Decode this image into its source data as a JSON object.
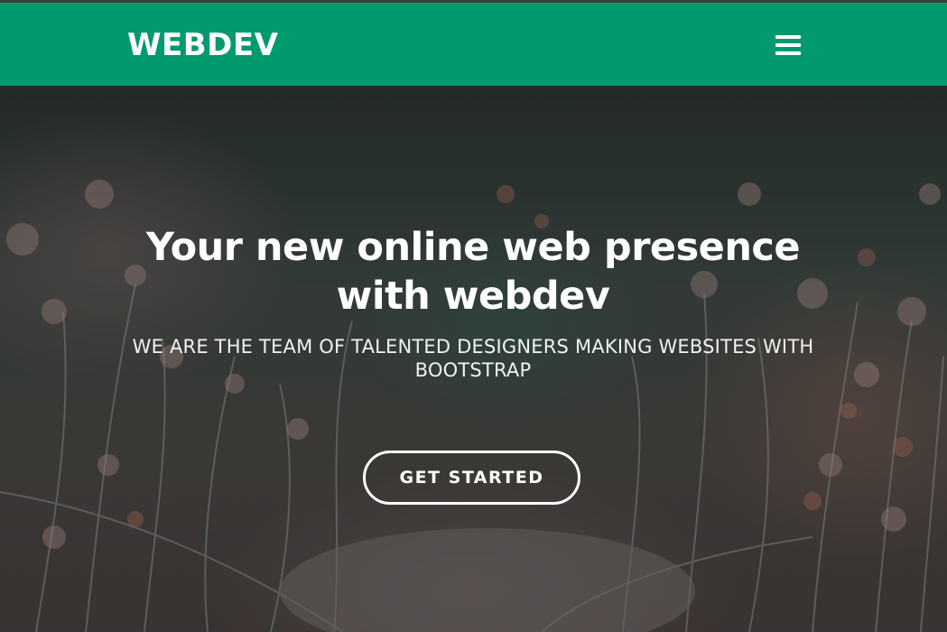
{
  "navbar": {
    "brand": "WEBDEV",
    "menu_icon": "hamburger-menu-icon",
    "background": "#009a6e"
  },
  "hero": {
    "title": "Your new online web presence with webdev",
    "subtitle": "WE ARE THE TEAM OF TALENTED DESIGNERS MAKING WEBSITES WITH BOOTSTRAP",
    "cta_label": "GET STARTED",
    "background_image": "blurred-grass-flowers-photo"
  },
  "colors": {
    "accent": "#009a6e",
    "hero_text": "#ffffff"
  }
}
